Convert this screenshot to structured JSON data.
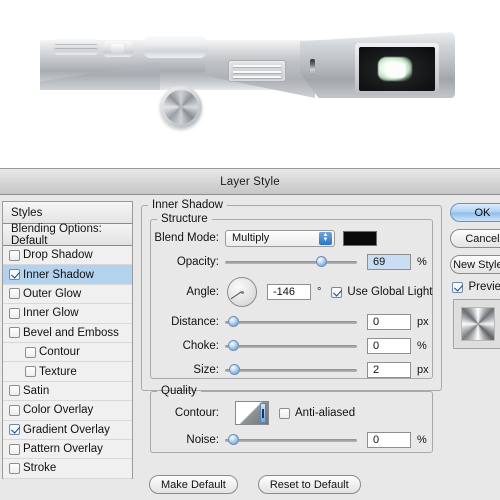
{
  "photo": {
    "alt": "silver compact camera top view",
    "parts": {
      "viewfinder": "viewfinder-window",
      "shutter_dial": "shutter-speed-dial",
      "mode_dial": "mode-dial",
      "knob": "lens-release-knob",
      "grille": "speaker-grille",
      "pin": "strap-pin"
    }
  },
  "dialog": {
    "title": "Layer Style"
  },
  "styles_panel": {
    "styles_label": "Styles",
    "blending_options": "Blending Options: Default",
    "effects": [
      {
        "label": "Drop Shadow",
        "checked": false,
        "selected": false,
        "sub": false
      },
      {
        "label": "Inner Shadow",
        "checked": true,
        "selected": true,
        "sub": false
      },
      {
        "label": "Outer Glow",
        "checked": false,
        "selected": false,
        "sub": false
      },
      {
        "label": "Inner Glow",
        "checked": false,
        "selected": false,
        "sub": false
      },
      {
        "label": "Bevel and Emboss",
        "checked": false,
        "selected": false,
        "sub": false
      },
      {
        "label": "Contour",
        "checked": false,
        "selected": false,
        "sub": true
      },
      {
        "label": "Texture",
        "checked": false,
        "selected": false,
        "sub": true
      },
      {
        "label": "Satin",
        "checked": false,
        "selected": false,
        "sub": false
      },
      {
        "label": "Color Overlay",
        "checked": false,
        "selected": false,
        "sub": false
      },
      {
        "label": "Gradient Overlay",
        "checked": true,
        "selected": false,
        "sub": false
      },
      {
        "label": "Pattern Overlay",
        "checked": false,
        "selected": false,
        "sub": false
      },
      {
        "label": "Stroke",
        "checked": false,
        "selected": false,
        "sub": false
      }
    ]
  },
  "inner_shadow": {
    "legend": "Inner Shadow",
    "structure": {
      "legend": "Structure",
      "blend_mode": {
        "label": "Blend Mode:",
        "value": "Multiply",
        "color": "#0a0a0a"
      },
      "opacity": {
        "label": "Opacity:",
        "value": "69",
        "unit": "%",
        "percent": 69
      },
      "angle": {
        "label": "Angle:",
        "value": "-146",
        "unit": "°",
        "degrees": -146,
        "use_global_light": {
          "label": "Use Global Light",
          "checked": true
        }
      },
      "distance": {
        "label": "Distance:",
        "value": "0",
        "unit": "px",
        "percent": 2
      },
      "choke": {
        "label": "Choke:",
        "value": "0",
        "unit": "%",
        "percent": 2
      },
      "size": {
        "label": "Size:",
        "value": "2",
        "unit": "px",
        "percent": 3
      }
    },
    "quality": {
      "legend": "Quality",
      "contour": {
        "label": "Contour:"
      },
      "anti_aliased": {
        "label": "Anti-aliased",
        "checked": false
      },
      "noise": {
        "label": "Noise:",
        "value": "0",
        "unit": "%",
        "percent": 2
      }
    }
  },
  "footer": {
    "make_default": "Make Default",
    "reset_to_default": "Reset to Default"
  },
  "right_panel": {
    "ok": "OK",
    "cancel": "Cancel",
    "new_style": "New Style...",
    "preview": {
      "label": "Preview",
      "checked": true
    }
  }
}
